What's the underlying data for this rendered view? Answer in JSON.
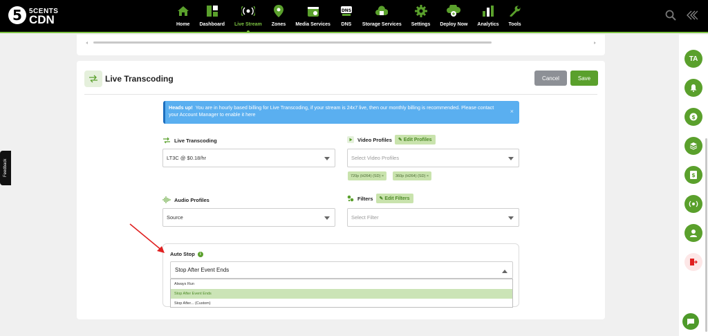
{
  "brand": {
    "top": "5CENTS",
    "bottom": "CDN",
    "mark": "5"
  },
  "nav": [
    {
      "label": "Home",
      "icon": "home-icon"
    },
    {
      "label": "Dashboard",
      "icon": "dashboard-icon"
    },
    {
      "label": "Live Stream",
      "icon": "live-stream-icon",
      "active": true
    },
    {
      "label": "Zones",
      "icon": "zones-icon"
    },
    {
      "label": "Media Services",
      "icon": "media-services-icon"
    },
    {
      "label": "DNS",
      "icon": "dns-icon"
    },
    {
      "label": "Storage Services",
      "icon": "storage-icon"
    },
    {
      "label": "Settings",
      "icon": "settings-icon"
    },
    {
      "label": "Deploy Now",
      "icon": "deploy-icon"
    },
    {
      "label": "Analytics",
      "icon": "analytics-icon"
    },
    {
      "label": "Tools",
      "icon": "tools-icon"
    }
  ],
  "feedback_label": "Feedback",
  "avatar_initials": "TA",
  "page": {
    "title": "Live Transcoding",
    "cancel_label": "Cancel",
    "save_label": "Save"
  },
  "alert": {
    "heading": "Heads up!",
    "message": "You are in hourly based billing for Live Transcoding, if your stream is 24x7 live, then our monthly billing is recommended. Please contact your Account Manager to enable it here",
    "close": "×"
  },
  "live_transcoding": {
    "label": "Live Transcoding",
    "value": "LT3C @ $0.18/hr"
  },
  "video_profiles": {
    "label": "Video Profiles",
    "edit_label": "Edit Profiles",
    "placeholder": "Select Video Profiles",
    "tags": [
      "720p (H264) (SD) ×",
      "360p (H264) (SD) ×"
    ]
  },
  "audio_profiles": {
    "label": "Audio Profiles",
    "value": "Source"
  },
  "filters": {
    "label": "Filters",
    "edit_label": "Edit Filters",
    "placeholder": "Select Filter"
  },
  "auto_stop": {
    "label": "Auto Stop",
    "info": "i",
    "value": "Stop After Event Ends",
    "options": [
      "Always Run",
      "Stop After Event Ends",
      "Stop After... (Custom)"
    ],
    "selected_index": 1
  },
  "colors": {
    "brand_green": "#7cc242",
    "save_green": "#5aa02c",
    "cancel_gray": "#8d9096",
    "alert_blue": "#5aaff0",
    "arrow_red": "#e02020"
  }
}
